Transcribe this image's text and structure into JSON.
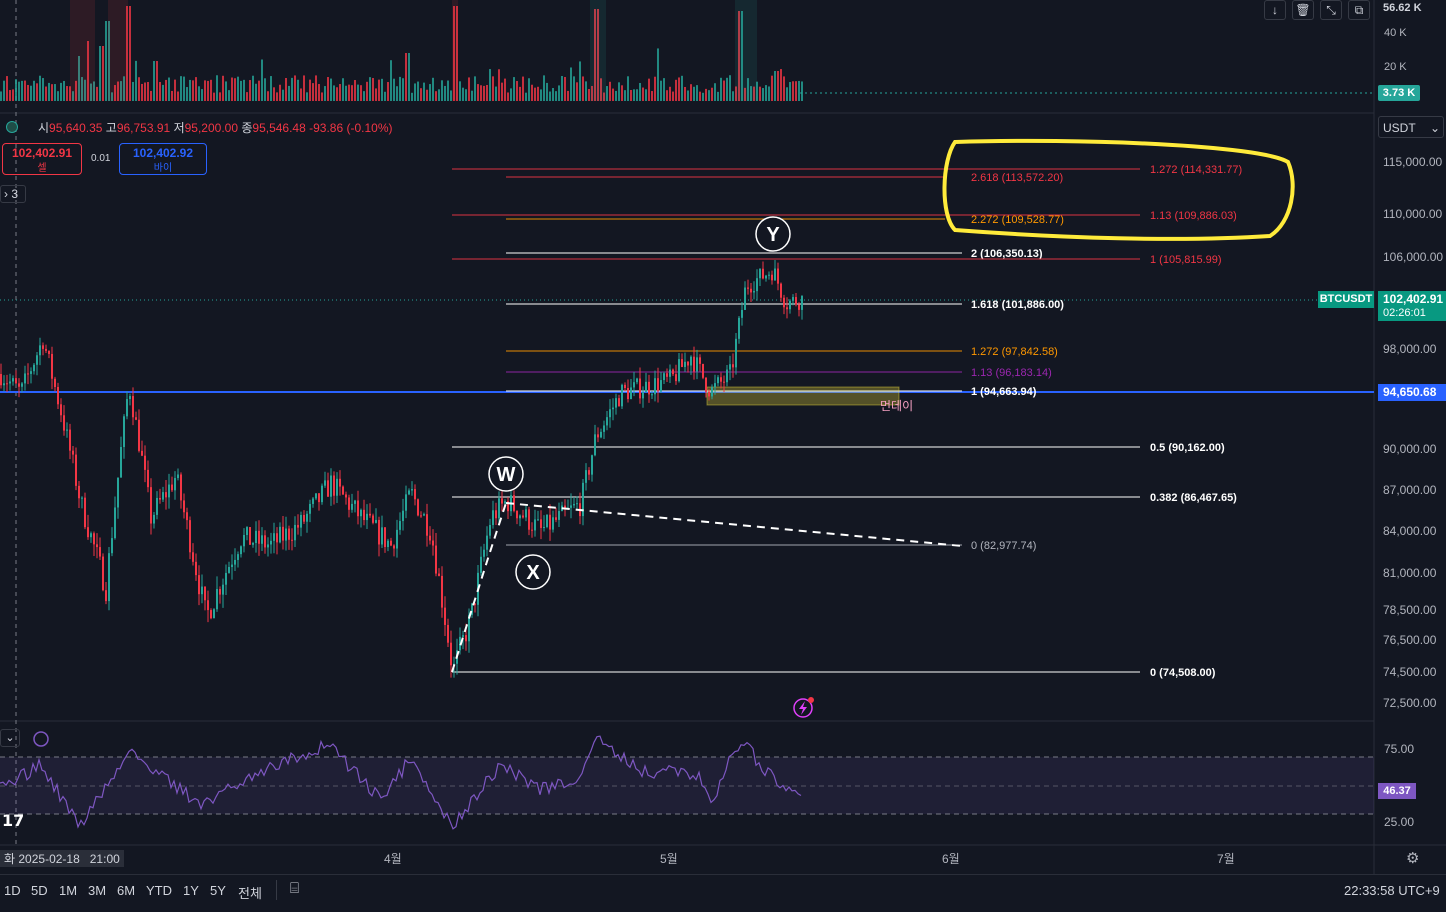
{
  "ohlc": {
    "open_label": "시",
    "open": "95,640.35",
    "high_label": "고",
    "high": "96,753.91",
    "low_label": "저",
    "low": "95,200.00",
    "close_label": "종",
    "close": "95,546.48",
    "change": "-93.86 (-0.10%)"
  },
  "trade": {
    "sell_price": "102,402.91",
    "sell_label": "셀",
    "spread": "0.01",
    "buy_price": "102,402.92",
    "buy_label": "바이"
  },
  "indicator_count": "3",
  "quote_currency": "USDT",
  "price_axis": {
    "ticks": [
      {
        "label": "115,000.00",
        "price": 115000
      },
      {
        "label": "110,000.00",
        "price": 110000
      },
      {
        "label": "106,000.00",
        "price": 106000
      },
      {
        "label": "98,000.00",
        "price": 98000
      },
      {
        "label": "90,000.00",
        "price": 90000
      },
      {
        "label": "87,000.00",
        "price": 87000
      },
      {
        "label": "84,000.00",
        "price": 84000
      },
      {
        "label": "81,000.00",
        "price": 81000
      },
      {
        "label": "78,500.00",
        "price": 78500
      },
      {
        "label": "76,500.00",
        "price": 76500
      },
      {
        "label": "74,500.00",
        "price": 74500
      },
      {
        "label": "72,500.00",
        "price": 72500
      }
    ],
    "current_symbol": "BTCUSDT",
    "current_price": "102,402.91",
    "countdown": "02:26:01",
    "blue_line_price": "94,650.68"
  },
  "volume_axis": {
    "ticks": [
      "56.62 K",
      "40 K",
      "20 K"
    ],
    "current": "3.73 K"
  },
  "rsi_axis": {
    "ticks": [
      "75.00",
      "25.00"
    ],
    "current": "46.37"
  },
  "time_axis": {
    "crosshair": "화 2025-02-18   21:00",
    "ticks": [
      "4월",
      "5월",
      "6월",
      "7월"
    ]
  },
  "fib_levels": [
    {
      "label": "2.618 (113,572.20)",
      "price": 113572.2,
      "color": "#f23645"
    },
    {
      "label": "1.272 (114,331.77)",
      "price": 114331.77,
      "color": "#f23645"
    },
    {
      "label": "2.272 (109,528.77)",
      "price": 109528.77,
      "color": "#ff9800"
    },
    {
      "label": "1.13 (109,886.03)",
      "price": 109886.03,
      "color": "#f23645"
    },
    {
      "label": "2 (106,350.13)",
      "price": 106350.13,
      "color": "#ffffff"
    },
    {
      "label": "1 (105,815.99)",
      "price": 105815.99,
      "color": "#f23645"
    },
    {
      "label": "1.618 (101,886.00)",
      "price": 101886.0,
      "color": "#ffffff"
    },
    {
      "label": "1.272 (97,842.58)",
      "price": 97842.58,
      "color": "#ff9800"
    },
    {
      "label": "1.13 (96,183.14)",
      "price": 96183.14,
      "color": "#9c27b0"
    },
    {
      "label": "1 (94,663.94)",
      "price": 94663.94,
      "color": "#ffffff"
    },
    {
      "label": "0.5 (90,162.00)",
      "price": 90162.0,
      "color": "#ffffff"
    },
    {
      "label": "0.382 (86,467.65)",
      "price": 86467.65,
      "color": "#ffffff"
    },
    {
      "label": "0 (82,977.74)",
      "price": 82977.74,
      "color": "#b2b5be"
    },
    {
      "label": "0 (74,508.00)",
      "price": 74508.0,
      "color": "#ffffff"
    }
  ],
  "wave_labels": [
    "W",
    "X",
    "Y"
  ],
  "zone_label": "먼데이",
  "timeframes": [
    "1D",
    "5D",
    "1M",
    "3M",
    "6M",
    "YTD",
    "1Y",
    "5Y",
    "전체"
  ],
  "clock": "22:33:58 UTC+9",
  "colors": {
    "background": "#131722",
    "up": "#26a69a",
    "down": "#f23645",
    "highlight": "#ffeb3b",
    "rsi": "#7e57c2",
    "blue_line": "#2962ff"
  }
}
